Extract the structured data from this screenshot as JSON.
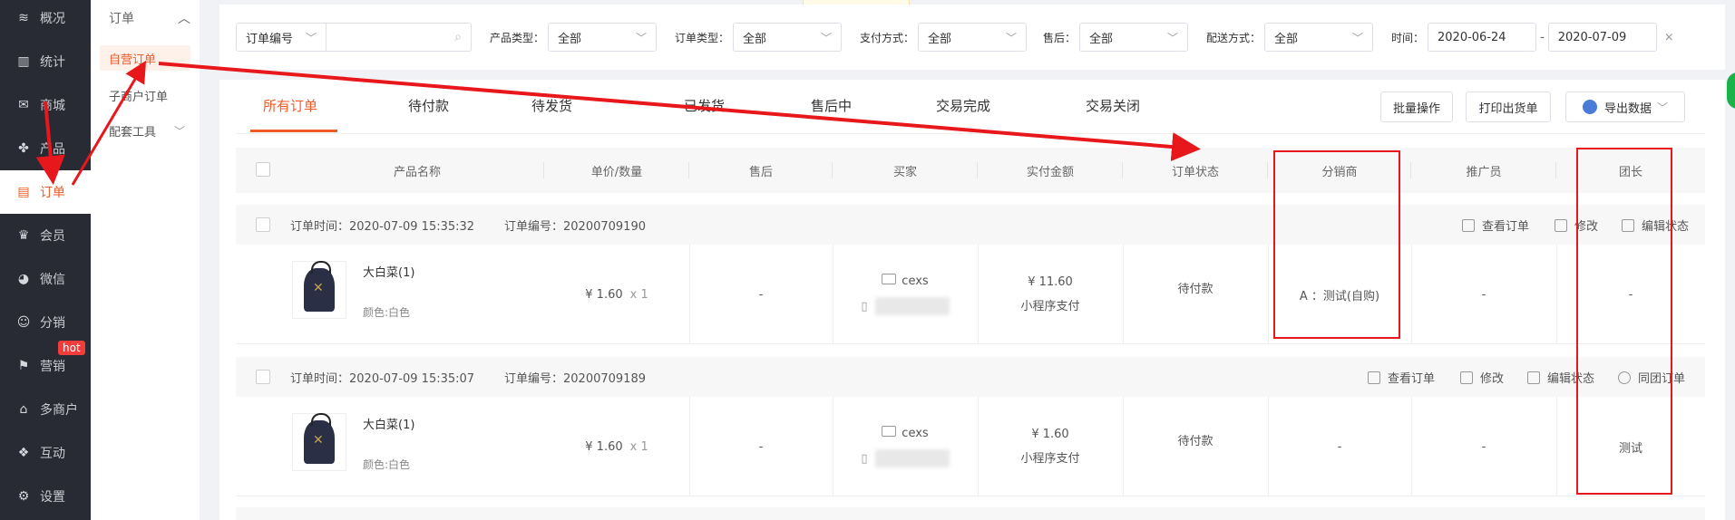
{
  "nav": {
    "items": [
      {
        "icon": "layers-icon",
        "glyph": "≋",
        "label": "概况"
      },
      {
        "icon": "chart-icon",
        "glyph": "▥",
        "label": "统计"
      },
      {
        "icon": "mail-icon",
        "glyph": "✉",
        "label": "商城"
      },
      {
        "icon": "product-icon",
        "glyph": "✤",
        "label": "产品"
      },
      {
        "icon": "order-icon",
        "glyph": "▤",
        "label": "订单"
      },
      {
        "icon": "crown-icon",
        "glyph": "♛",
        "label": "会员"
      },
      {
        "icon": "wechat-icon",
        "glyph": "◕",
        "label": "微信"
      },
      {
        "icon": "distribution-icon",
        "glyph": "☺",
        "label": "分销"
      },
      {
        "icon": "flag-icon",
        "glyph": "⚑",
        "label": "营销"
      },
      {
        "icon": "merchant-icon",
        "glyph": "⌂",
        "label": "多商户"
      },
      {
        "icon": "interact-icon",
        "glyph": "❖",
        "label": "互动"
      },
      {
        "icon": "settings-icon",
        "glyph": "⚙",
        "label": "设置"
      }
    ],
    "hot_badge": "hot"
  },
  "subnav": {
    "title": "订单",
    "items": [
      "自营订单",
      "子商户订单",
      "配套工具"
    ]
  },
  "filters": {
    "order_no_select": "订单编号",
    "product_type_label": "产品类型：",
    "product_type_value": "全部",
    "order_type_label": "订单类型：",
    "order_type_value": "全部",
    "pay_label": "支付方式：",
    "pay_value": "全部",
    "aftersale_label": "售后：",
    "aftersale_value": "全部",
    "delivery_label": "配送方式：",
    "delivery_value": "全部",
    "time_label": "时间：",
    "date_from": "2020-06-24",
    "date_sep": "-",
    "date_to": "2020-07-09",
    "clear": "×"
  },
  "tabs": [
    "所有订单",
    "待付款",
    "待发货",
    "已发货",
    "售后中",
    "交易完成",
    "交易关闭"
  ],
  "buttons": {
    "batch": "批量操作",
    "print": "打印出货单",
    "export": "导出数据"
  },
  "columns": [
    "产品名称",
    "单价/数量",
    "售后",
    "买家",
    "实付金额",
    "订单状态",
    "分销商",
    "推广员",
    "团长"
  ],
  "orders": [
    {
      "time": "订单时间：2020-07-09 15:35:32",
      "no": "订单编号：20200709190",
      "actions": [
        "查看订单",
        "修改",
        "编辑状态"
      ],
      "product": "大白菜(1)",
      "spec": "颜色:白色",
      "price": "¥ 1.60",
      "qty": "x 1",
      "aftersale": "-",
      "buyer": "cexs",
      "paid": "¥ 11.60",
      "pay_method": "小程序支付",
      "status": "待付款",
      "distributor": "A ：测试(自购)",
      "promoter": "-",
      "leader": "-"
    },
    {
      "time": "订单时间：2020-07-09 15:35:07",
      "no": "订单编号：20200709189",
      "actions": [
        "查看订单",
        "修改",
        "编辑状态",
        "同团订单"
      ],
      "product": "大白菜(1)",
      "spec": "颜色:白色",
      "price": "¥ 1.60",
      "qty": "x 1",
      "aftersale": "-",
      "buyer": "cexs",
      "paid": "¥ 1.60",
      "pay_method": "小程序支付",
      "status": "待付款",
      "distributor": "-",
      "promoter": "-",
      "leader": "测试"
    }
  ],
  "colors": {
    "accent": "#f05a28",
    "annotation": "#e8171b",
    "nav_bg": "#282b33"
  }
}
